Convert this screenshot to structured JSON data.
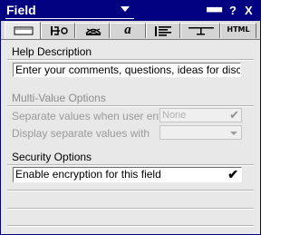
{
  "window": {
    "title": "Field",
    "title_buttons": [
      "▀▀▀",
      "?",
      "X"
    ]
  },
  "tabs": [
    {
      "name": "tab-basics",
      "icon": "field-box-icon",
      "label": ""
    },
    {
      "name": "tab-control",
      "icon": "key-icon",
      "label": ""
    },
    {
      "name": "tab-advanced",
      "icon": "hat-icon",
      "label": ""
    },
    {
      "name": "tab-font",
      "icon": "italic-a-icon",
      "label": "a"
    },
    {
      "name": "tab-paragraph",
      "icon": "paragraph-align-icon",
      "label": ""
    },
    {
      "name": "tab-hide-when",
      "icon": "hide-when-icon",
      "label": ""
    },
    {
      "name": "tab-html",
      "icon": "html-icon",
      "label": "HTML"
    }
  ],
  "help": {
    "heading": "Help Description",
    "value": "Enter your comments, questions, ideas for discussion."
  },
  "multi_value": {
    "heading": "Multi-Value Options",
    "separate_enter_label": "Separate values when user enters",
    "separate_enter_value": "None",
    "separate_enter_check": "✔",
    "separate_display_label": "Display separate values with",
    "separate_display_value": ""
  },
  "security": {
    "heading": "Security Options",
    "encryption_label": "Enable encryption for this field",
    "encryption_check": "✔"
  },
  "colors": {
    "title_bar": "#000080",
    "panel": "#e8e8e8"
  }
}
